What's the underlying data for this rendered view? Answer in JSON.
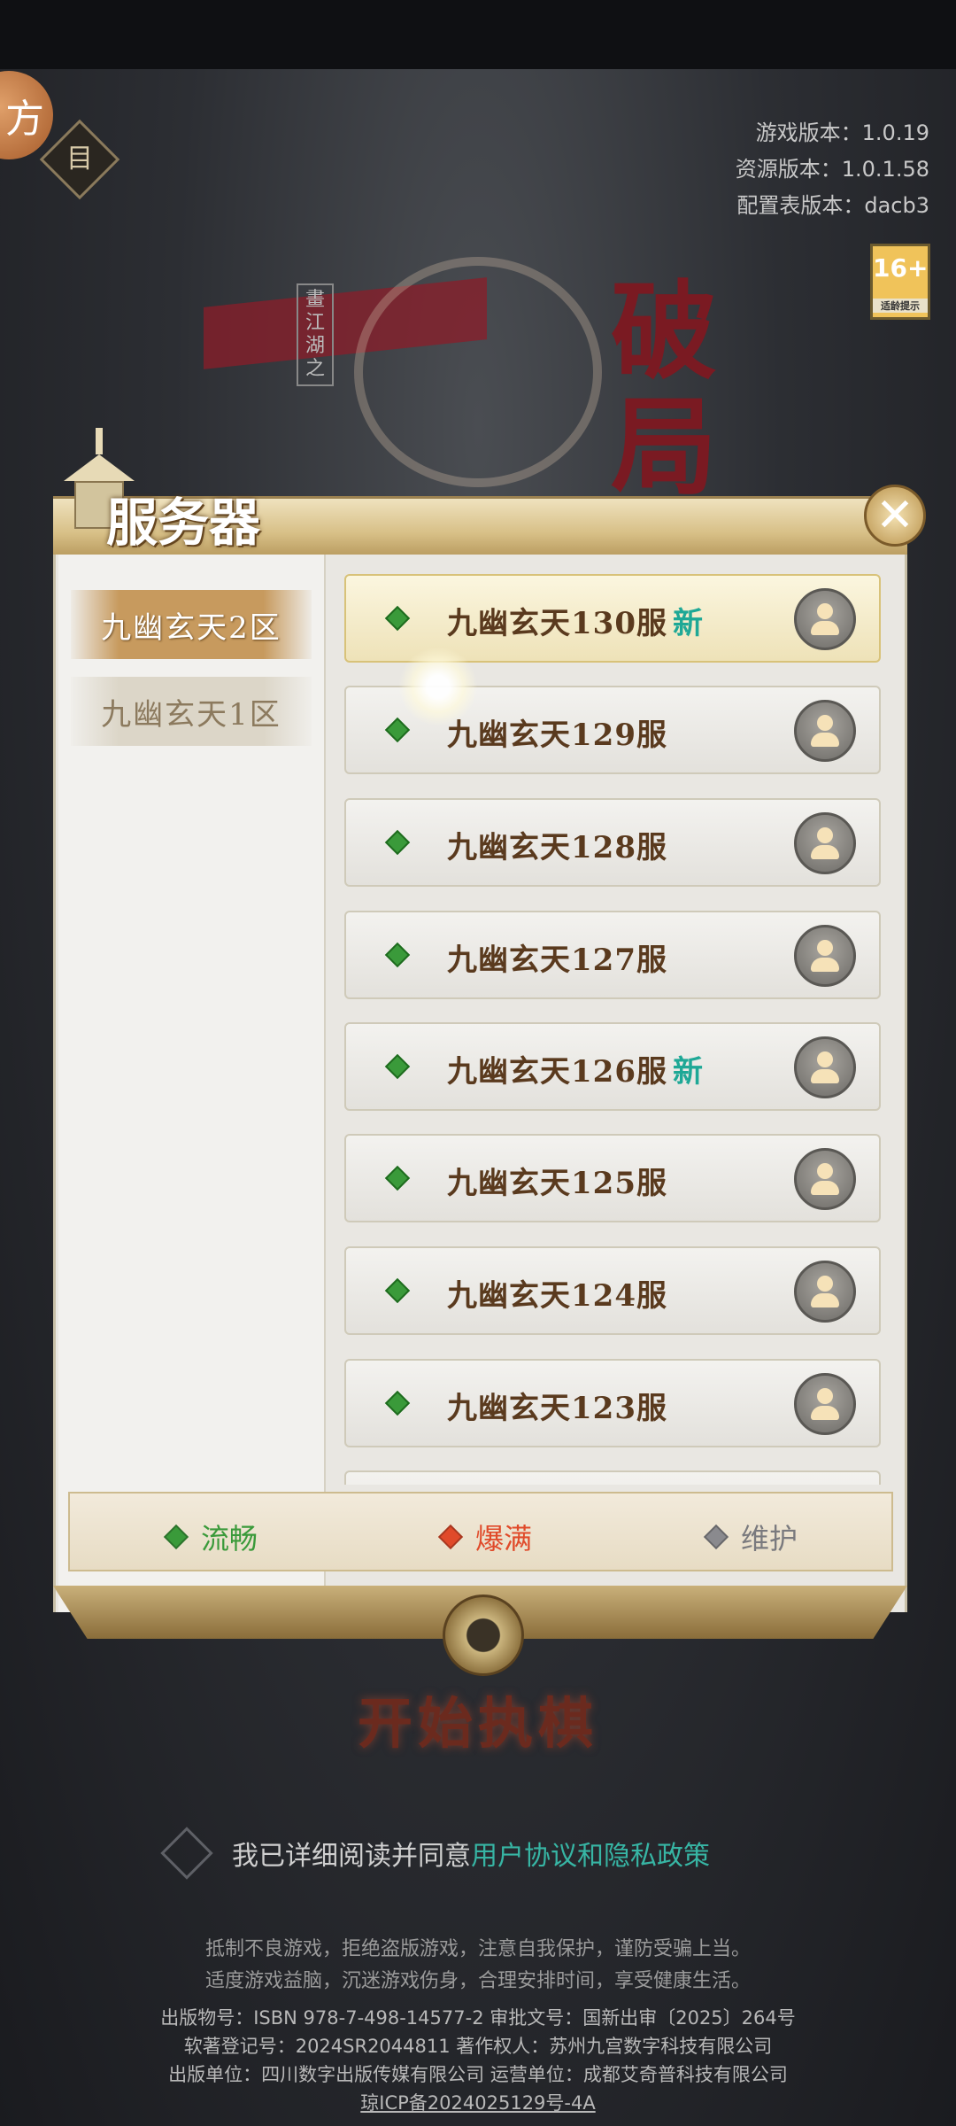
{
  "top": {
    "corner_badge": "方",
    "menu_icon_glyph": "目",
    "version_lines": [
      "游戏版本：1.0.19",
      "资源版本：1.0.1.58",
      "配置表版本：dacb3"
    ],
    "age_badge": {
      "rating": "16+",
      "caption": "适龄提示"
    }
  },
  "logo": {
    "tag": "畫江湖之",
    "title": "破局"
  },
  "panel": {
    "title": "服务器",
    "close_icon": "close-icon",
    "zones": [
      {
        "label": "九幽玄天2区",
        "active": true
      },
      {
        "label": "九幽玄天1区",
        "active": false
      }
    ],
    "servers": [
      {
        "name": "九幽玄天130服",
        "tag": "新",
        "selected": true
      },
      {
        "name": "九幽玄天129服",
        "tag": "",
        "selected": false
      },
      {
        "name": "九幽玄天128服",
        "tag": "",
        "selected": false
      },
      {
        "name": "九幽玄天127服",
        "tag": "",
        "selected": false
      },
      {
        "name": "九幽玄天126服",
        "tag": "新",
        "selected": false
      },
      {
        "name": "九幽玄天125服",
        "tag": "",
        "selected": false
      },
      {
        "name": "九幽玄天124服",
        "tag": "",
        "selected": false
      },
      {
        "name": "九幽玄天123服",
        "tag": "",
        "selected": false
      }
    ],
    "legend": [
      {
        "label": "流畅",
        "color": "#3a9a3a"
      },
      {
        "label": "爆满",
        "color": "#e04a2a"
      },
      {
        "label": "维护",
        "color": "#8a8a8e"
      }
    ]
  },
  "start_button": "开始执棋",
  "agreement": {
    "prefix": "我已详细阅读并同意",
    "link": "用户协议和隐私政策"
  },
  "notice_lines": [
    "抵制不良游戏，拒绝盗版游戏，注意自我保护，谨防受骗上当。",
    "适度游戏益脑，沉迷游戏伤身，合理安排时间，享受健康生活。"
  ],
  "credits_lines": [
    "出版物号：ISBN 978-7-498-14577-2  审批文号：国新出审〔2025〕264号",
    "软著登记号：2024SR2044811  著作权人：苏州九宫数字科技有限公司",
    "出版单位：四川数字出版传媒有限公司 运营单位：成都艾奇普科技有限公司"
  ],
  "icp": "琼ICP备2024025129号-4A"
}
